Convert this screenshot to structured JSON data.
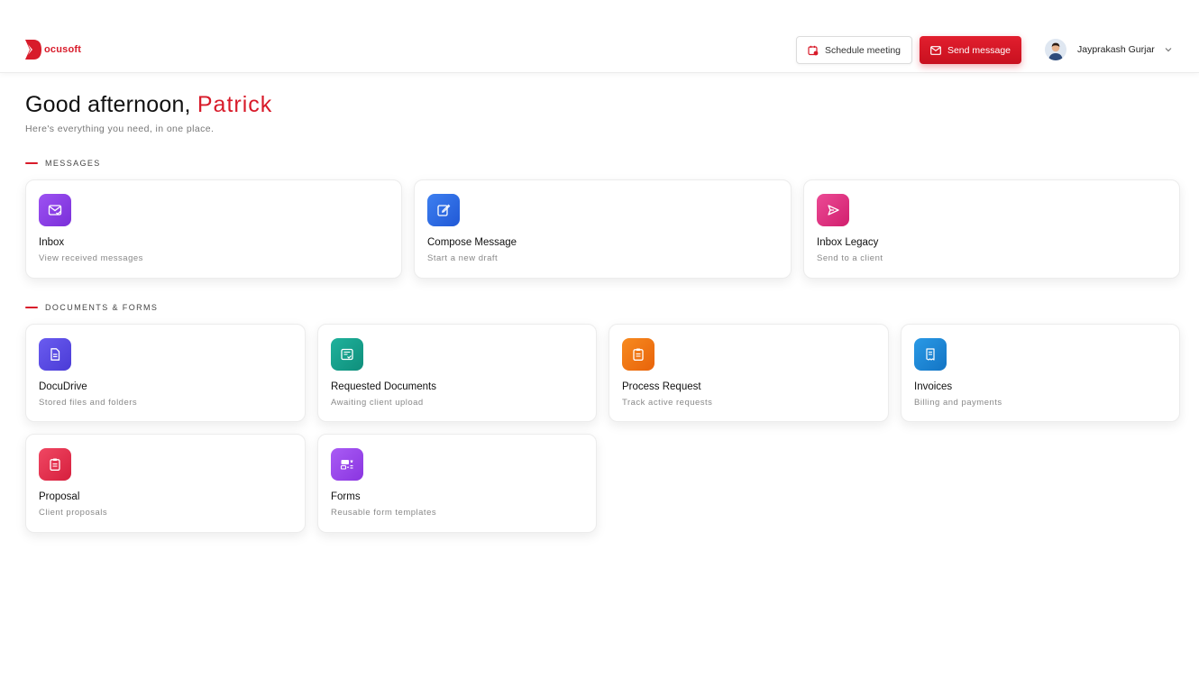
{
  "brand": {
    "name": "ocusoft",
    "accent": "#d81b2a"
  },
  "header": {
    "schedule_label": "Schedule meeting",
    "send_label": "Send message",
    "user_name": "Jayprakash Gurjar"
  },
  "greeting": {
    "prefix": "Good afternoon,",
    "name": "Patrick",
    "subtitle": "Here's everything you need, in one place."
  },
  "sections": {
    "messages": "MESSAGES",
    "documents": "DOCUMENTS & FORMS"
  },
  "messages": [
    {
      "title": "Inbox",
      "desc": "View received messages",
      "icon": "mail-check-icon",
      "color": "#8b3fe6"
    },
    {
      "title": "Compose Message",
      "desc": "Start a new draft",
      "icon": "edit-icon",
      "color": "#2f6fe8"
    },
    {
      "title": "Inbox Legacy",
      "desc": "Send to a client",
      "icon": "send-icon",
      "color": "#e0337f"
    }
  ],
  "documents": [
    {
      "title": "DocuDrive",
      "desc": "Stored files and folders",
      "icon": "file-icon",
      "color": "#5b4de6"
    },
    {
      "title": "Requested Documents",
      "desc": "Awaiting client upload",
      "icon": "doc-check-icon",
      "color": "#14a08d"
    },
    {
      "title": "Process Request",
      "desc": "Track active requests",
      "icon": "clipboard-icon",
      "color": "#f1780e"
    },
    {
      "title": "Invoices",
      "desc": "Billing and payments",
      "icon": "receipt-icon",
      "color": "#1b88d6"
    },
    {
      "title": "Proposal",
      "desc": "Client proposals",
      "icon": "clipboard-icon",
      "color": "#e6334d"
    },
    {
      "title": "Forms",
      "desc": "Reusable form templates",
      "icon": "form-icon",
      "color": "#9a4df0"
    }
  ]
}
